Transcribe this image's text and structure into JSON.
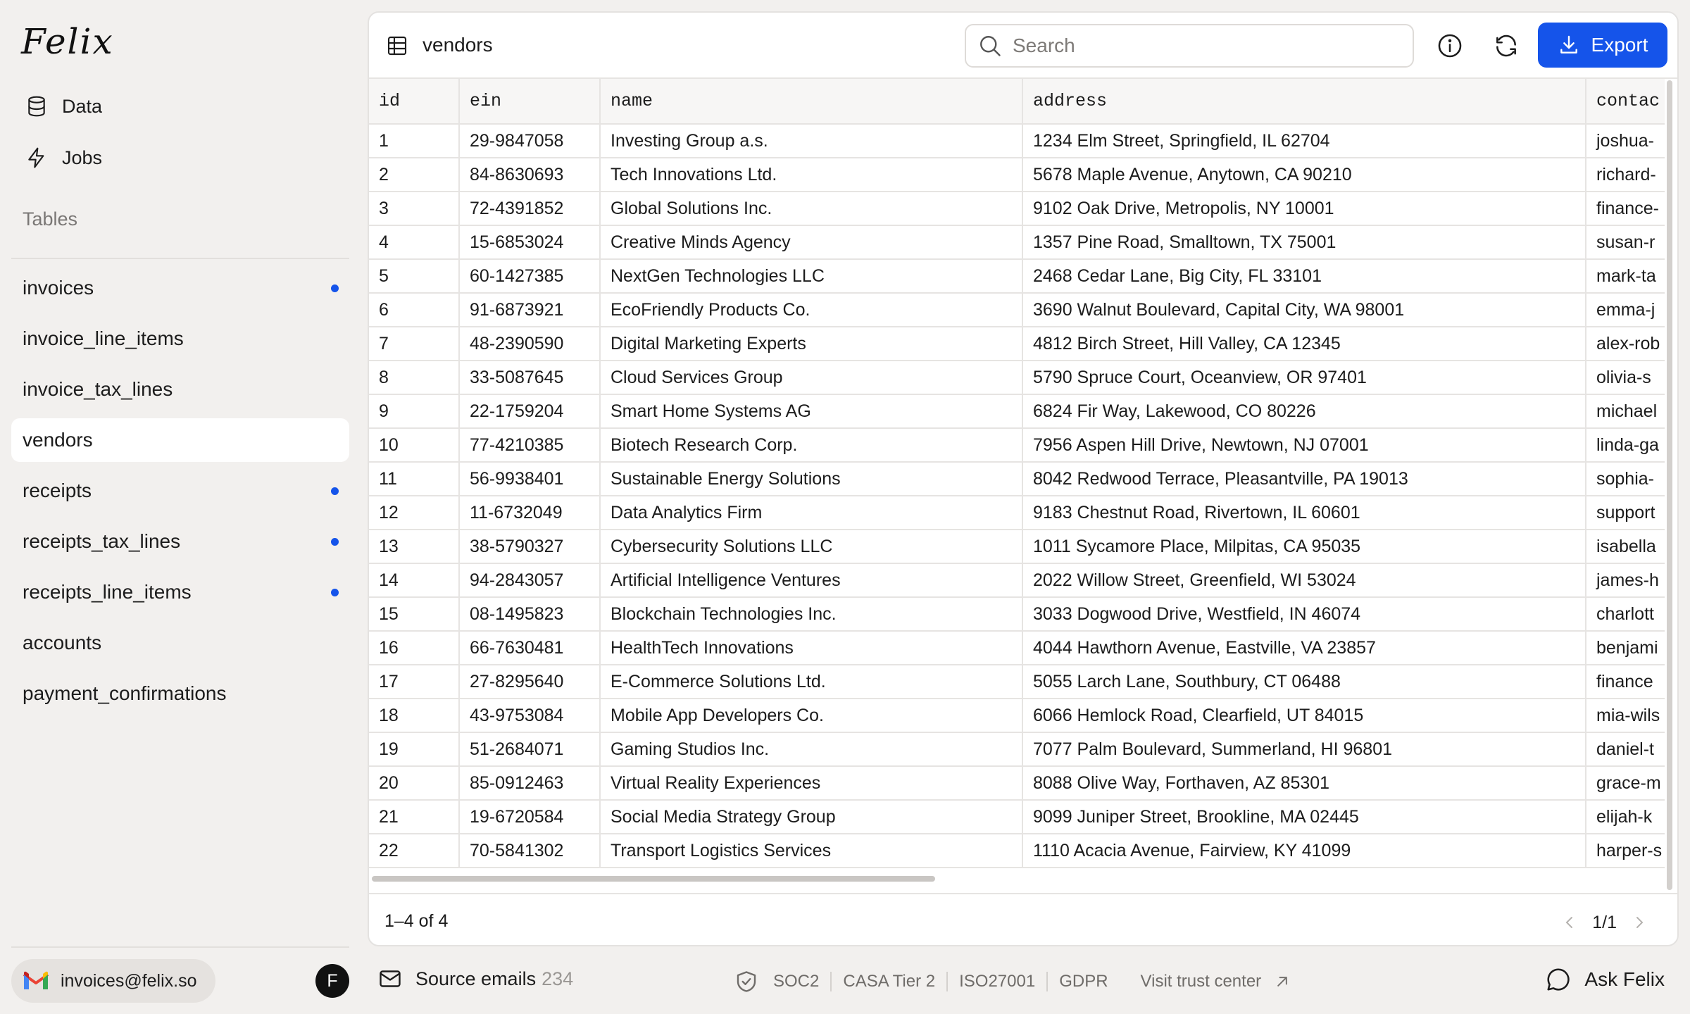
{
  "app": {
    "logo": "Felix"
  },
  "sidebar": {
    "nav": [
      {
        "label": "Data",
        "icon": "database-icon"
      },
      {
        "label": "Jobs",
        "icon": "lightning-icon"
      }
    ],
    "tables_title": "Tables",
    "tables": [
      {
        "label": "invoices",
        "has_update": true
      },
      {
        "label": "invoice_line_items",
        "has_update": false
      },
      {
        "label": "invoice_tax_lines",
        "has_update": false
      },
      {
        "label": "vendors",
        "has_update": false,
        "active": true
      },
      {
        "label": "receipts",
        "has_update": true
      },
      {
        "label": "receipts_tax_lines",
        "has_update": true
      },
      {
        "label": "receipts_line_items",
        "has_update": true
      },
      {
        "label": "accounts",
        "has_update": false
      },
      {
        "label": "payment_confirmations",
        "has_update": false
      }
    ],
    "account_email": "invoices@felix.so",
    "avatar_initial": "F"
  },
  "colors": {
    "accent": "#1554ea",
    "dot": "#1554ea",
    "gmail_red": "#ea4335"
  },
  "main": {
    "title": "vendors",
    "search_placeholder": "Search",
    "export_label": "Export",
    "columns": [
      "id",
      "ein",
      "name",
      "address",
      "contac"
    ],
    "rows": [
      [
        "1",
        "29-9847058",
        "Investing Group a.s.",
        "1234 Elm Street, Springfield, IL 62704",
        "joshua-"
      ],
      [
        "2",
        "84-8630693",
        "Tech Innovations Ltd.",
        "5678 Maple Avenue, Anytown, CA 90210",
        "richard-"
      ],
      [
        "3",
        "72-4391852",
        "Global Solutions Inc.",
        "9102 Oak Drive, Metropolis, NY 10001",
        "finance-"
      ],
      [
        "4",
        "15-6853024",
        "Creative Minds Agency",
        "1357 Pine Road, Smalltown, TX 75001",
        "susan-r"
      ],
      [
        "5",
        "60-1427385",
        "NextGen Technologies LLC",
        "2468 Cedar Lane, Big City, FL 33101",
        "mark-ta"
      ],
      [
        "6",
        "91-6873921",
        "EcoFriendly Products Co.",
        "3690 Walnut Boulevard, Capital City, WA 98001",
        "emma-j"
      ],
      [
        "7",
        "48-2390590",
        "Digital Marketing Experts",
        "4812 Birch Street, Hill Valley, CA 12345",
        "alex-rob"
      ],
      [
        "8",
        "33-5087645",
        "Cloud Services Group",
        "5790 Spruce Court, Oceanview, OR 97401",
        "olivia-s"
      ],
      [
        "9",
        "22-1759204",
        "Smart Home Systems AG",
        "6824 Fir Way, Lakewood, CO 80226",
        "michael"
      ],
      [
        "10",
        "77-4210385",
        "Biotech Research Corp.",
        "7956 Aspen Hill Drive, Newtown, NJ 07001",
        "linda-ga"
      ],
      [
        "11",
        "56-9938401",
        "Sustainable Energy Solutions",
        "8042 Redwood Terrace, Pleasantville, PA 19013",
        "sophia-"
      ],
      [
        "12",
        "11-6732049",
        "Data Analytics Firm",
        "9183 Chestnut Road, Rivertown, IL 60601",
        "support"
      ],
      [
        "13",
        "38-5790327",
        "Cybersecurity Solutions LLC",
        "1011 Sycamore Place, Milpitas, CA 95035",
        "isabella"
      ],
      [
        "14",
        "94-2843057",
        "Artificial Intelligence Ventures",
        "2022 Willow Street, Greenfield, WI 53024",
        "james-h"
      ],
      [
        "15",
        "08-1495823",
        "Blockchain Technologies Inc.",
        "3033 Dogwood Drive, Westfield, IN 46074",
        "charlott"
      ],
      [
        "16",
        "66-7630481",
        "HealthTech Innovations",
        "4044 Hawthorn Avenue, Eastville, VA 23857",
        "benjami"
      ],
      [
        "17",
        "27-8295640",
        "E-Commerce Solutions Ltd.",
        "5055 Larch Lane, Southbury, CT 06488",
        "finance"
      ],
      [
        "18",
        "43-9753084",
        "Mobile App Developers Co.",
        "6066 Hemlock Road, Clearfield, UT 84015",
        "mia-wils"
      ],
      [
        "19",
        "51-2684071",
        "Gaming Studios Inc.",
        "7077 Palm Boulevard, Summerland, HI 96801",
        "daniel-t"
      ],
      [
        "20",
        "85-0912463",
        "Virtual Reality Experiences",
        "8088 Olive Way, Forthaven, AZ 85301",
        "grace-m"
      ],
      [
        "21",
        "19-6720584",
        "Social Media Strategy Group",
        "9099 Juniper Street, Brookline, MA 02445",
        "elijah-k"
      ],
      [
        "22",
        "70-5841302",
        "Transport Logistics Services",
        "1110 Acacia Avenue, Fairview, KY 41099",
        "harper-s"
      ]
    ],
    "range_label": "1–4 of 4",
    "page_label": "1/1"
  },
  "bottom": {
    "source_emails_label": "Source emails",
    "source_emails_count": "234",
    "compliance": [
      "SOC2",
      "CASA Tier 2",
      "ISO27001",
      "GDPR"
    ],
    "trust_link": "Visit trust center",
    "ask_label": "Ask Felix"
  }
}
